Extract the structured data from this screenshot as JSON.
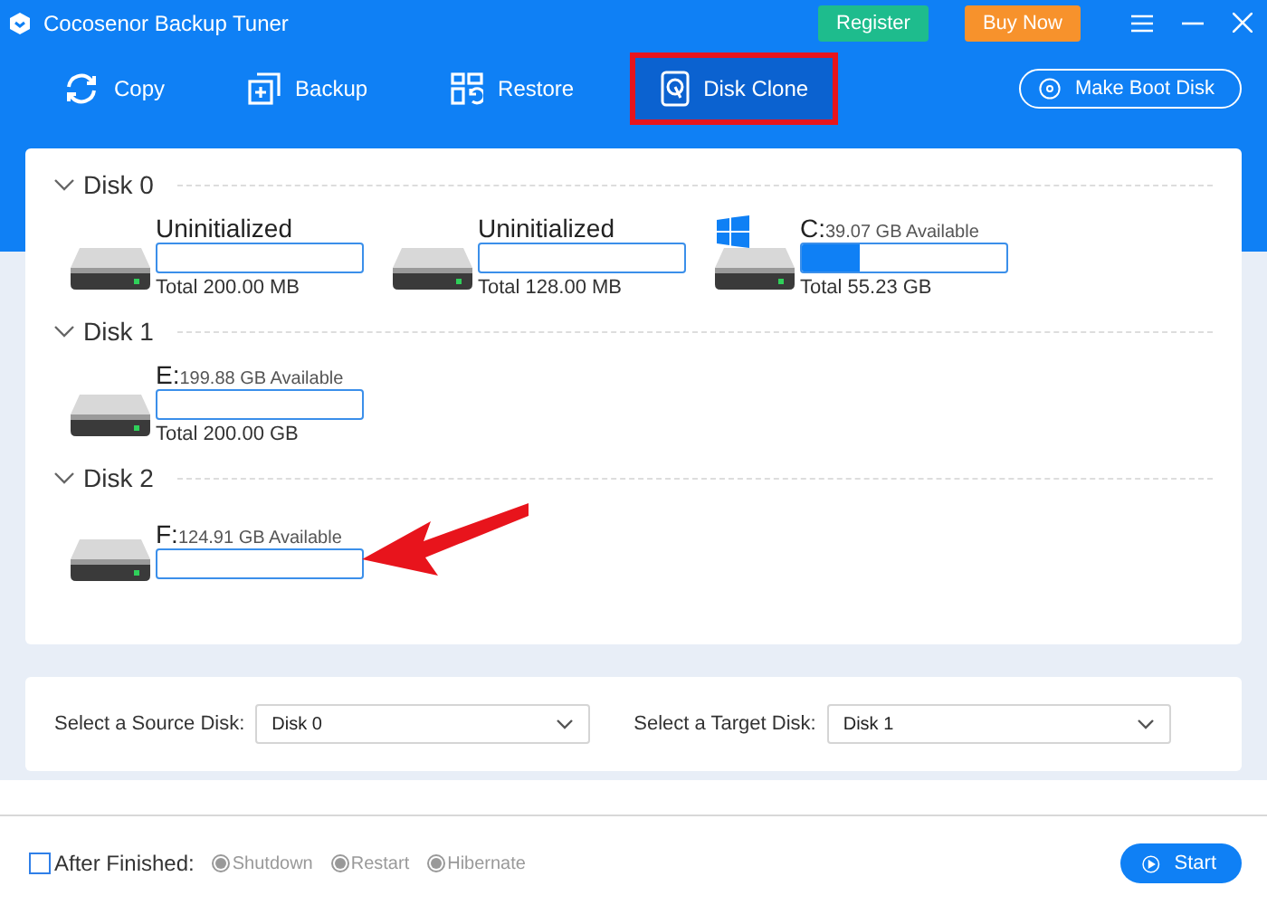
{
  "window": {
    "title": "Cocosenor Backup Tuner"
  },
  "title_buttons": [
    "Register",
    "Buy Now"
  ],
  "tabs": [
    {
      "label": "Copy",
      "kind": "copy",
      "selected": false,
      "highlighted": false
    },
    {
      "label": "Backup",
      "kind": "backup",
      "selected": false,
      "highlighted": false
    },
    {
      "label": "Restore",
      "kind": "restore",
      "selected": false,
      "highlighted": false
    },
    {
      "label": "Disk Clone",
      "kind": "clone",
      "selected": true,
      "highlighted": true
    }
  ],
  "boot_button": "Make Boot Disk",
  "disks": [
    {
      "name": "Disk 0",
      "expanded": true,
      "partitions": [
        {
          "label": "Uninitialized",
          "level": 0,
          "total": "Total 200.00 MB",
          "system": false
        },
        {
          "label": "Uninitialized",
          "level": 0,
          "total": "Total 128.00 MB",
          "system": false
        },
        {
          "label": "C:",
          "available": "39.07 GB Available",
          "level": 0.28,
          "total": "Total 55.23 GB",
          "system": true
        }
      ]
    },
    {
      "name": "Disk 1",
      "expanded": true,
      "partitions": [
        {
          "label": "E:",
          "available": "199.88 GB Available",
          "level": 0,
          "total": "Total 200.00 GB",
          "system": false
        }
      ]
    },
    {
      "name": "Disk 2",
      "expanded": true,
      "partitions": [
        {
          "label": "F:",
          "available": "124.91 GB Available",
          "level": 0,
          "system": false
        }
      ]
    }
  ],
  "source": {
    "label": "Select a Source Disk:",
    "value": "Disk 0"
  },
  "target": {
    "label": "Select a Target Disk:",
    "value": "Disk 1"
  },
  "after_finished": {
    "label": "After Finished:",
    "checked": false,
    "options": [
      {
        "label": "Shutdown",
        "disabled": true
      },
      {
        "label": "Restart",
        "disabled": true
      },
      {
        "label": "Hibernate",
        "disabled": true
      }
    ]
  },
  "start_button": "Start"
}
